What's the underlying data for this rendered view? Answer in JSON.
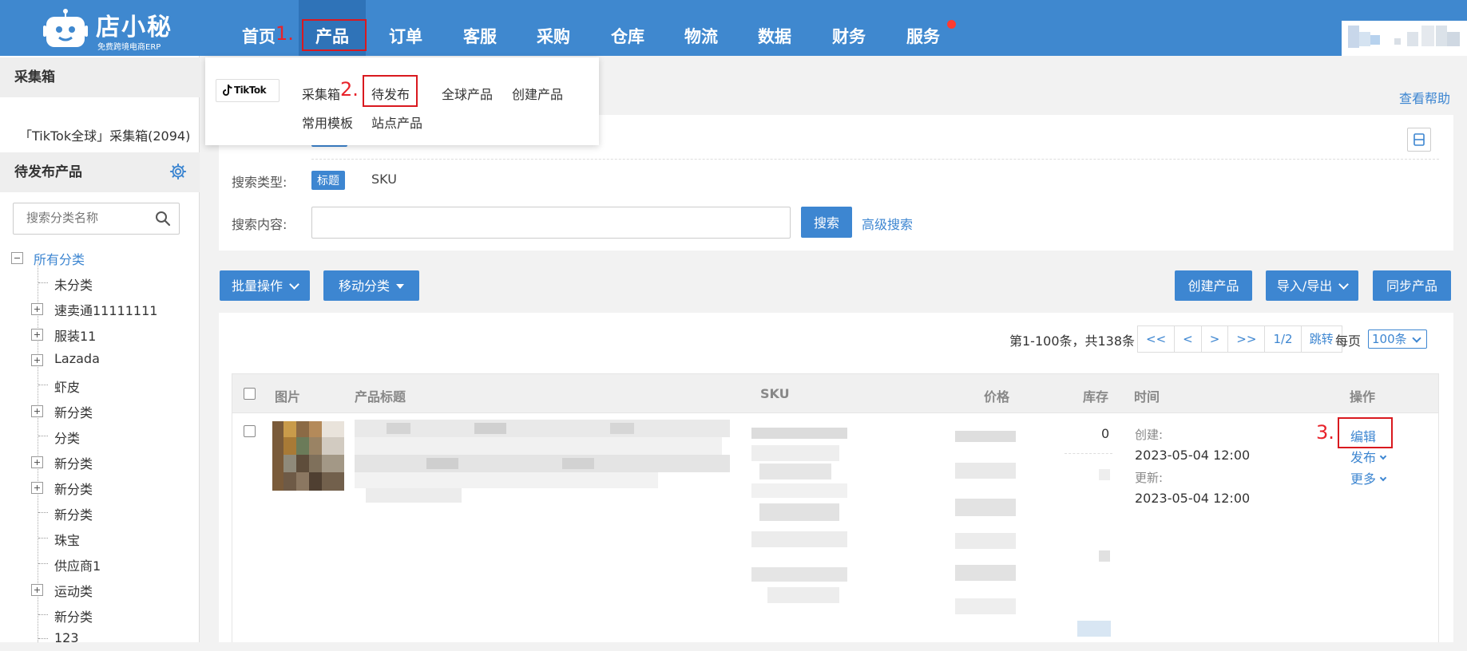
{
  "brand": {
    "name": "店小秘",
    "tagline": "免费跨境电商ERP"
  },
  "nav": {
    "items": [
      {
        "label": "首页"
      },
      {
        "label": "产品"
      },
      {
        "label": "订单"
      },
      {
        "label": "客服"
      },
      {
        "label": "采购"
      },
      {
        "label": "仓库"
      },
      {
        "label": "物流"
      },
      {
        "label": "数据"
      },
      {
        "label": "财务"
      },
      {
        "label": "服务"
      }
    ]
  },
  "annotations": {
    "step1": "1.",
    "step2": "2.",
    "step3": "3."
  },
  "dropdown": {
    "platform": "TikTok",
    "items": [
      "采集箱",
      "待发布",
      "全球产品",
      "创建产品",
      "常用模板",
      "站点产品"
    ]
  },
  "sidebar": {
    "collect_header": "采集箱",
    "collect_item": "「TikTok全球」采集箱(2094)",
    "pending_header": "待发布产品",
    "search_placeholder": "搜索分类名称",
    "tree": [
      {
        "label": "所有分类",
        "type": "root"
      },
      {
        "label": "未分类",
        "type": "leaf"
      },
      {
        "label": "速卖通11111111",
        "type": "node"
      },
      {
        "label": "服装11",
        "type": "node"
      },
      {
        "label": "Lazada",
        "type": "node"
      },
      {
        "label": "虾皮",
        "type": "leaf"
      },
      {
        "label": "新分类",
        "type": "node"
      },
      {
        "label": "分类",
        "type": "leaf"
      },
      {
        "label": "新分类",
        "type": "node"
      },
      {
        "label": "新分类",
        "type": "node"
      },
      {
        "label": "新分类",
        "type": "leaf"
      },
      {
        "label": "珠宝",
        "type": "leaf"
      },
      {
        "label": "供应商1",
        "type": "leaf"
      },
      {
        "label": "运动类",
        "type": "node"
      },
      {
        "label": "新分类",
        "type": "leaf"
      },
      {
        "label": "123",
        "type": "leaf"
      }
    ]
  },
  "main": {
    "help_link": "查看帮助",
    "search_type_label": "搜索类型:",
    "search_type_options": [
      "标题",
      "SKU"
    ],
    "search_content_label": "搜索内容:",
    "search_button": "搜索",
    "advanced_search": "高级搜索",
    "toolbar": {
      "batch": "批量操作",
      "move": "移动分类",
      "create": "创建产品",
      "import_export": "导入/导出",
      "sync": "同步产品"
    },
    "pager": {
      "info": "第1-100条，共138条",
      "first": "<<",
      "prev": "<",
      "next": ">",
      "last": ">>",
      "page": "1/2",
      "jump": "跳转",
      "per_page_label": "每页",
      "per_page_value": "100条"
    },
    "table": {
      "headers": [
        "图片",
        "产品标题",
        "SKU",
        "价格",
        "库存",
        "时间",
        "操作"
      ],
      "row": {
        "stock": "0",
        "created_label": "创建:",
        "created": "2023-05-04 12:00",
        "updated_label": "更新:",
        "updated": "2023-05-04 12:00",
        "actions": {
          "edit": "编辑",
          "publish": "发布",
          "more": "更多"
        }
      }
    }
  },
  "colors": {
    "topbar": "#3f88cf",
    "accent": "#3d86d1",
    "annotation": "#e8232b"
  }
}
